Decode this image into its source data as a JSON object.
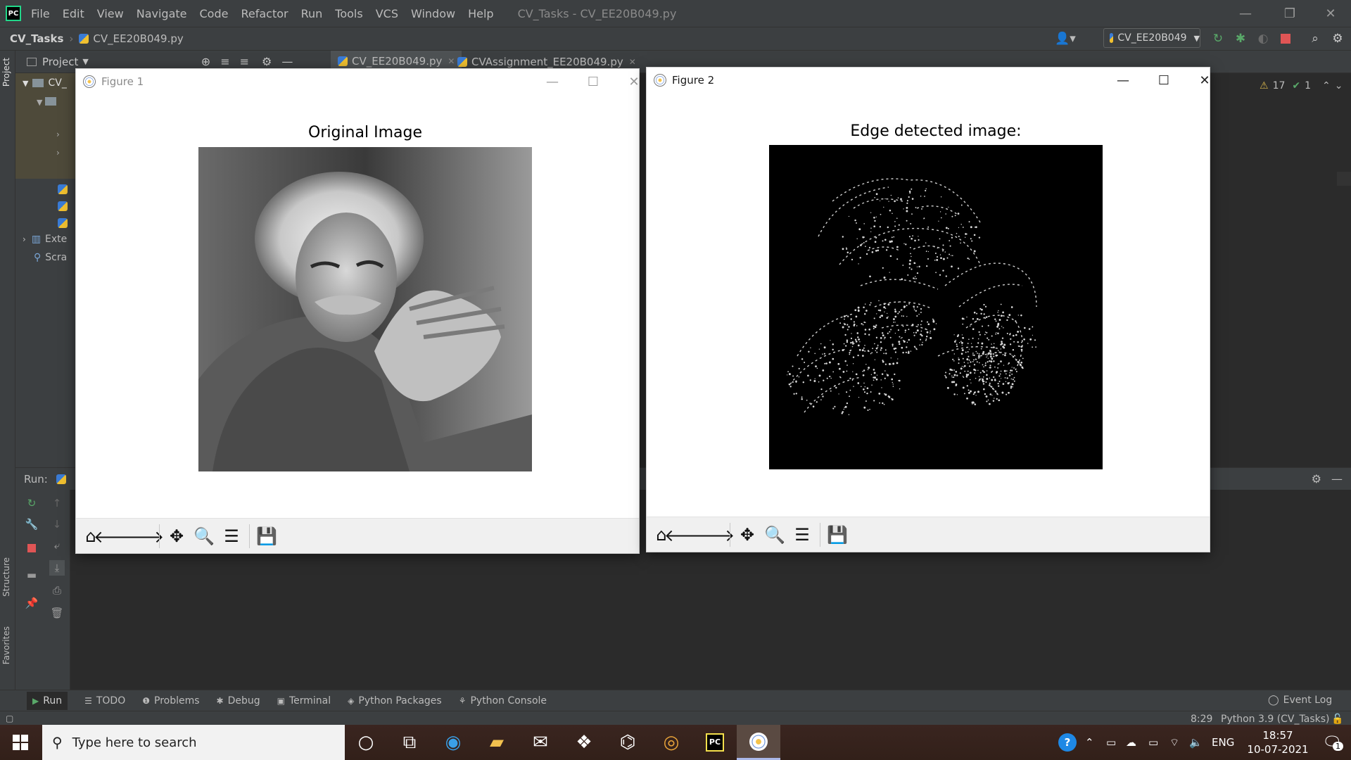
{
  "ide": {
    "menu": [
      "File",
      "Edit",
      "View",
      "Navigate",
      "Code",
      "Refactor",
      "Run",
      "Tools",
      "VCS",
      "Window",
      "Help"
    ],
    "window_title": "CV_Tasks - CV_EE20B049.py",
    "breadcrumb_project": "CV_Tasks",
    "breadcrumb_file": "CV_EE20B049.py",
    "run_config": "CV_EE20B049",
    "project_panel_title": "Project",
    "tree_root": "CV_",
    "tree_items": [
      "Exte",
      "Scra"
    ],
    "editor_tabs": [
      "CV_EE20B049.py",
      "CVAssignment_EE20B049.py"
    ],
    "inspection_warnings": "17",
    "inspection_ok": "1",
    "run_label": "Run:",
    "side_labels": [
      "Project",
      "Structure",
      "Favorites"
    ],
    "bottom_tabs": [
      "Run",
      "TODO",
      "Problems",
      "Debug",
      "Terminal",
      "Python Packages",
      "Python Console"
    ],
    "event_log": "Event Log",
    "caret_position": "8:29",
    "interpreter": "Python 3.9 (CV_Tasks)"
  },
  "figure1": {
    "window_title": "Figure 1",
    "plot_title": "Original Image"
  },
  "figure2": {
    "window_title": "Figure 2",
    "plot_title": "Edge detected image:"
  },
  "taskbar": {
    "search_placeholder": "Type here to search",
    "language": "ENG",
    "time": "18:57",
    "date": "10-07-2021",
    "notification_count": "1"
  },
  "colors": {
    "ide_bg": "#2b2b2b",
    "ide_panel": "#3c3f41",
    "accent": "#4a88c7",
    "run_green": "#59a869",
    "stop_red": "#e05555"
  }
}
